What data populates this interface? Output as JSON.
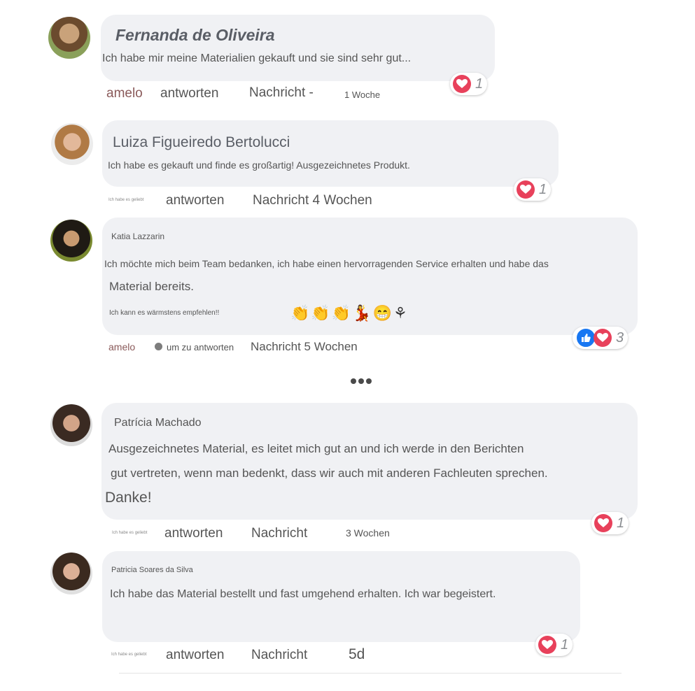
{
  "comments": [
    {
      "name": "Fernanda de Oliveira",
      "text": "Ich habe mir meine Materialien gekauft und sie sind sehr gut...",
      "reaction_count": "1",
      "actions": {
        "like": "amelo",
        "reply": "antworten",
        "message": "Nachricht -",
        "time": "1 Woche"
      }
    },
    {
      "name": "Luiza Figueiredo Bertolucci",
      "text": "Ich habe es gekauft und finde es großartig! Ausgezeichnetes Produkt.",
      "reaction_count": "1",
      "actions": {
        "like": "Ich habe es geliebt",
        "reply": "antworten",
        "message": "Nachricht 4 Wochen"
      }
    },
    {
      "name": "Katia Lazzarin",
      "text1": "Ich möchte mich beim Team bedanken, ich habe einen hervorragenden Service erhalten und habe das",
      "text2": "Material bereits.",
      "text3": "Ich kann es wärmstens empfehlen!!",
      "emojis": [
        "👏",
        "👏",
        "👏",
        "💃",
        "😁",
        "⚘"
      ],
      "reaction_count": "3",
      "actions": {
        "like": "amelo",
        "reply": "um zu antworten",
        "message": "Nachricht 5 Wochen"
      }
    },
    {
      "name": "Patrícia Machado",
      "text1": "Ausgezeichnetes Material, es leitet mich gut an und ich werde in den Berichten",
      "text2": "gut vertreten, wenn man bedenkt, dass wir auch mit anderen Fachleuten sprechen.",
      "text3": "Danke!",
      "reaction_count": "1",
      "actions": {
        "like": "Ich habe es geliebt",
        "reply": "antworten",
        "message": "Nachricht",
        "time": "3 Wochen"
      }
    },
    {
      "name": "Patricia Soares da Silva",
      "text": "Ich habe das Material bestellt und fast umgehend erhalten. Ich war begeistert.",
      "reaction_count": "1",
      "actions": {
        "like": "Ich habe es geliebt",
        "reply": "antworten",
        "message": "Nachricht",
        "time": "5d"
      }
    }
  ],
  "colors": {
    "bubble": "#f0f1f4",
    "heart": "#e8415b",
    "like": "#1877f2",
    "like_text": "#8a5a5a"
  },
  "icons": {
    "more": "more-dots-icon",
    "heart": "heart-icon",
    "like": "thumbs-up-icon"
  }
}
